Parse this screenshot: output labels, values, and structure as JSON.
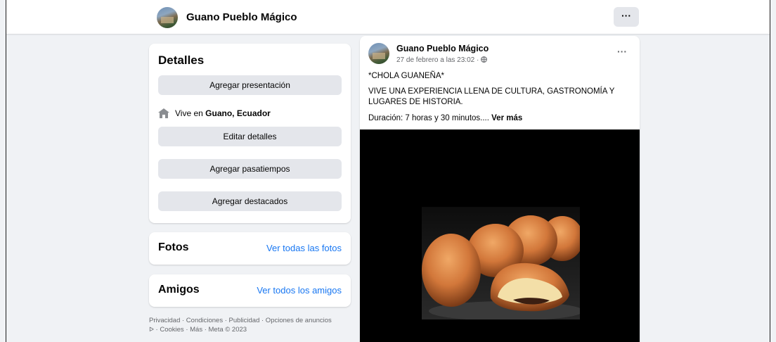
{
  "header": {
    "page_name": "Guano Pueblo Mágico",
    "more_label": "···"
  },
  "details": {
    "title": "Detalles",
    "add_intro": "Agregar presentación",
    "lives_prefix": "Vive en ",
    "lives_place": "Guano, Ecuador",
    "edit_details": "Editar detalles",
    "add_hobbies": "Agregar pasatiempos",
    "add_featured": "Agregar destacados"
  },
  "photos": {
    "title": "Fotos",
    "link": "Ver todas las fotos"
  },
  "friends": {
    "title": "Amigos",
    "link": "Ver todos los amigos"
  },
  "footer": {
    "line1": "Privacidad · Condiciones · Publicidad · Opciones de anuncios",
    "line2": " · Cookies · Más · Meta © 2023"
  },
  "post": {
    "author": "Guano Pueblo Mágico",
    "time": "27 de febrero a las 23:02 · ",
    "more_label": "···",
    "line1": "*CHOLA GUANEÑA*",
    "line2": "VIVE UNA EXPERIENCIA LLENA DE CULTURA, GASTRONOMÍA Y LUGARES DE HISTORIA.",
    "line3": "Duración: 7 horas y 30 minutos.... ",
    "see_more": "Ver más"
  },
  "icons": {
    "house": "house-icon",
    "globe": "globe-icon",
    "adchoices": "adchoices-icon"
  },
  "colors": {
    "link": "#1877f2",
    "button_bg": "#e4e6eb",
    "page_bg": "#f0f2f5"
  }
}
